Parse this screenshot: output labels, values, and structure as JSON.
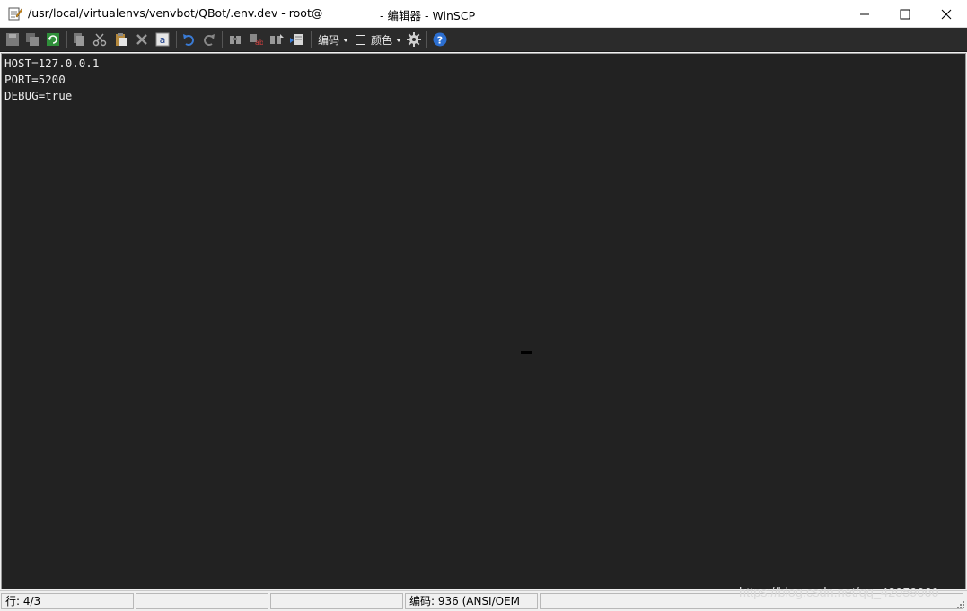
{
  "window": {
    "title_path": "/usr/local/virtualenvs/venvbot/QBot/.env.dev - root@",
    "title_app": "- 编辑器 - WinSCP",
    "controls": [
      "minimize",
      "maximize",
      "close"
    ]
  },
  "toolbar": {
    "encoding_label": "编码",
    "color_label": "颜色",
    "icons": [
      "save-icon",
      "save-all-icon",
      "reload-icon",
      "copy-icon",
      "cut-icon",
      "paste-icon",
      "delete-icon",
      "select-all-icon",
      "undo-icon",
      "redo-icon",
      "find-icon",
      "replace-icon",
      "find-next-icon",
      "goto-line-icon",
      "wrap-checkbox",
      "settings-gear-icon",
      "help-icon"
    ]
  },
  "editor": {
    "lines": [
      "HOST=127.0.0.1",
      "PORT=5200",
      "DEBUG=true"
    ],
    "background": "#222222",
    "text_color": "#ececec"
  },
  "statusbar": {
    "position": "行: 4/3",
    "encoding": "编码: 936  (ANSI/OEM"
  },
  "watermark": "https://blog.csdn.net/qq_42059060"
}
